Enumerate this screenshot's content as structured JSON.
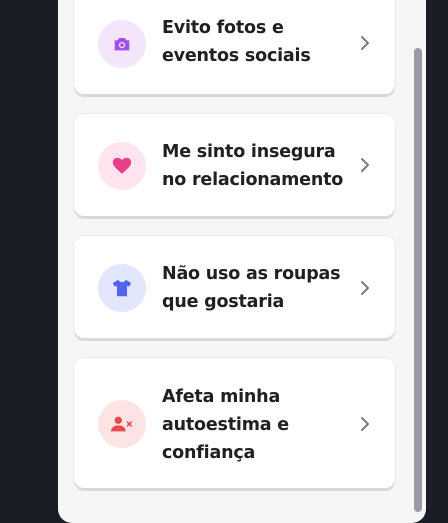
{
  "options": [
    {
      "label": "Evito fotos e eventos sociais",
      "icon": "camera-icon",
      "icon_bg": "#f3e6fb",
      "icon_color": "#a24ee8"
    },
    {
      "label": "Me sinto insegura no relacionamento",
      "icon": "heart-icon",
      "icon_bg": "#fde4ef",
      "icon_color": "#e83e8c"
    },
    {
      "label": "Não uso as roupas que gostaria",
      "icon": "shirt-icon",
      "icon_bg": "#e3e7fd",
      "icon_color": "#4f63ec"
    },
    {
      "label": "Afeta minha autoestima e confiança",
      "icon": "user-remove-icon",
      "icon_bg": "#fde4e4",
      "icon_color": "#e84a4a"
    }
  ]
}
